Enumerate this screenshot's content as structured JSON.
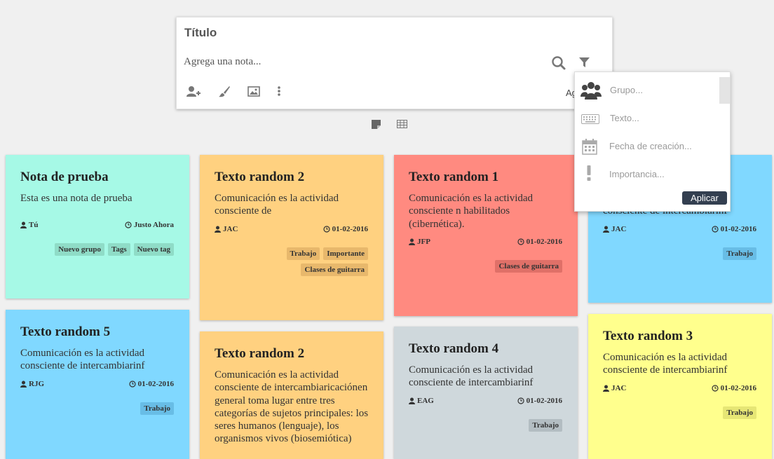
{
  "editor": {
    "title": "Título",
    "placeholder": "Agrega una nota...",
    "add_label": "Ag",
    "icons": [
      "add-user-icon",
      "brush-icon",
      "image-icon",
      "more-vert-icon",
      "search-icon",
      "filter-icon"
    ]
  },
  "view_toggle": {
    "icons": [
      "note-view-icon",
      "table-view-icon"
    ]
  },
  "filter_dropdown": {
    "items": [
      {
        "label": "Grupo...",
        "icon": "group-icon"
      },
      {
        "label": "Texto...",
        "icon": "keyboard-icon"
      },
      {
        "label": "Fecha de creación...",
        "icon": "calendar-icon"
      },
      {
        "label": "Importancia...",
        "icon": "exclamation-icon"
      }
    ],
    "apply_label": "Aplicar"
  },
  "notes": [
    {
      "title": "Nota de prueba",
      "body": "Esta es una nota de prueba",
      "author": "Tú",
      "date": "Justo Ahora",
      "tags": [
        "Nuevo grupo",
        "Tags",
        "Nuevo tag"
      ],
      "color": "#a6f9e6",
      "tag_color": "#8fdcc7"
    },
    {
      "title": "Texto random 2",
      "body": "Comunicación es la actividad consciente de",
      "author": "JAC",
      "date": "01-02-2016",
      "tags": [
        "Trabajo",
        "Importante",
        "Clases de guitarra"
      ],
      "color": "#ffd180",
      "tag_color": "#e8b86c"
    },
    {
      "title": "Texto random 1",
      "body": "Comunicación es la actividad consciente n habilitados (cibernética).",
      "author": "JFP",
      "date": "01-02-2016",
      "tags": [
        "Clases de guitarra"
      ],
      "color": "#ff8a80",
      "tag_color": "#e07068"
    },
    {
      "title": "",
      "body": "consciente de intercambiarinf",
      "author": "JAC",
      "date": "01-02-2016",
      "tags": [
        "Trabajo"
      ],
      "color": "#80d8ff",
      "tag_color": "#68bde6"
    },
    {
      "title": "Texto random 5",
      "body": "Comunicación es la actividad consciente de intercambiarinf",
      "author": "RJG",
      "date": "01-02-2016",
      "tags": [
        "Trabajo"
      ],
      "color": "#80d8ff",
      "tag_color": "#68bde6"
    },
    {
      "title": "Texto random 2",
      "body": "Comunicación es la actividad consciente de intercambiaricaciónen general toma lugar entre tres categorías de sujetos principales: los seres humanos (lenguaje), los organismos vivos (biosemiótica)",
      "author": "",
      "date": "",
      "tags": [],
      "color": "#ffd180",
      "tag_color": "#e8b86c"
    },
    {
      "title": "Texto random 4",
      "body": "Comunicación es la actividad consciente de intercambiarinf",
      "author": "EAG",
      "date": "01-02-2016",
      "tags": [
        "Trabajo"
      ],
      "color": "#cfd8dc",
      "tag_color": "#b3bdc2"
    },
    {
      "title": "Texto random 3",
      "body": "Comunicación es la actividad consciente de intercambiarinf",
      "author": "JAC",
      "date": "01-02-2016",
      "tags": [
        "Trabajo"
      ],
      "color": "#ffff8d",
      "tag_color": "#e6e675"
    }
  ]
}
